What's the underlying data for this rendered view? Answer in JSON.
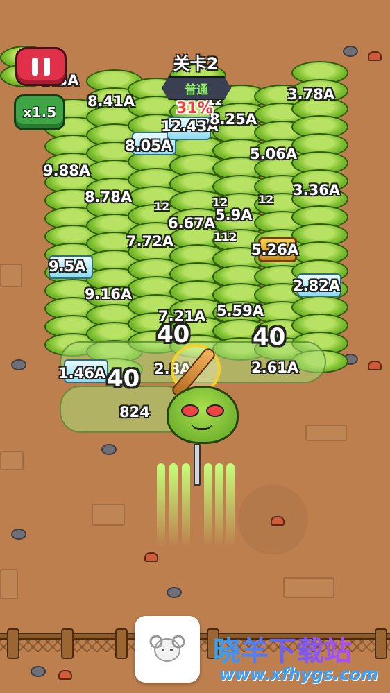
{
  "hud": {
    "level_title": "关卡2",
    "difficulty": "普通",
    "progress_percent": "31%",
    "speed_label": "x1.5"
  },
  "enemies": [
    {
      "label": "3.78A"
    },
    {
      "label": "8.41A"
    },
    {
      "label": "12.43A"
    },
    {
      "label": "8.25A"
    },
    {
      "label": "8.05A"
    },
    {
      "label": "5.06A"
    },
    {
      "label": "9.88A"
    },
    {
      "label": "3.36A"
    },
    {
      "label": "8.78A"
    },
    {
      "label": "5.9A"
    },
    {
      "label": "6.67A"
    },
    {
      "label": "7.72A"
    },
    {
      "label": "5.26A"
    },
    {
      "label": "9.5A"
    },
    {
      "label": "2.82A"
    },
    {
      "label": "9.16A"
    },
    {
      "label": "5.59A"
    },
    {
      "label": "7.21A"
    },
    {
      "label": "2.61A"
    },
    {
      "label": "1.46A"
    },
    {
      "label": "824"
    },
    {
      "label": "2.8A"
    },
    {
      "label": "9.3A"
    }
  ],
  "damage_numbers": [
    {
      "value": "40"
    },
    {
      "value": "40"
    },
    {
      "value": "40"
    }
  ],
  "small_damage": [
    {
      "value": "12"
    },
    {
      "value": "12"
    },
    {
      "value": "12"
    },
    {
      "value": "112"
    },
    {
      "value": "12"
    }
  ],
  "watermark": {
    "title": "晓羊下载站",
    "url": "www.xfhygs.com"
  },
  "colors": {
    "pause": "#e0304a",
    "speed": "#3fa444",
    "progress": "#f03a3a",
    "ground": "#bd7f4e"
  }
}
